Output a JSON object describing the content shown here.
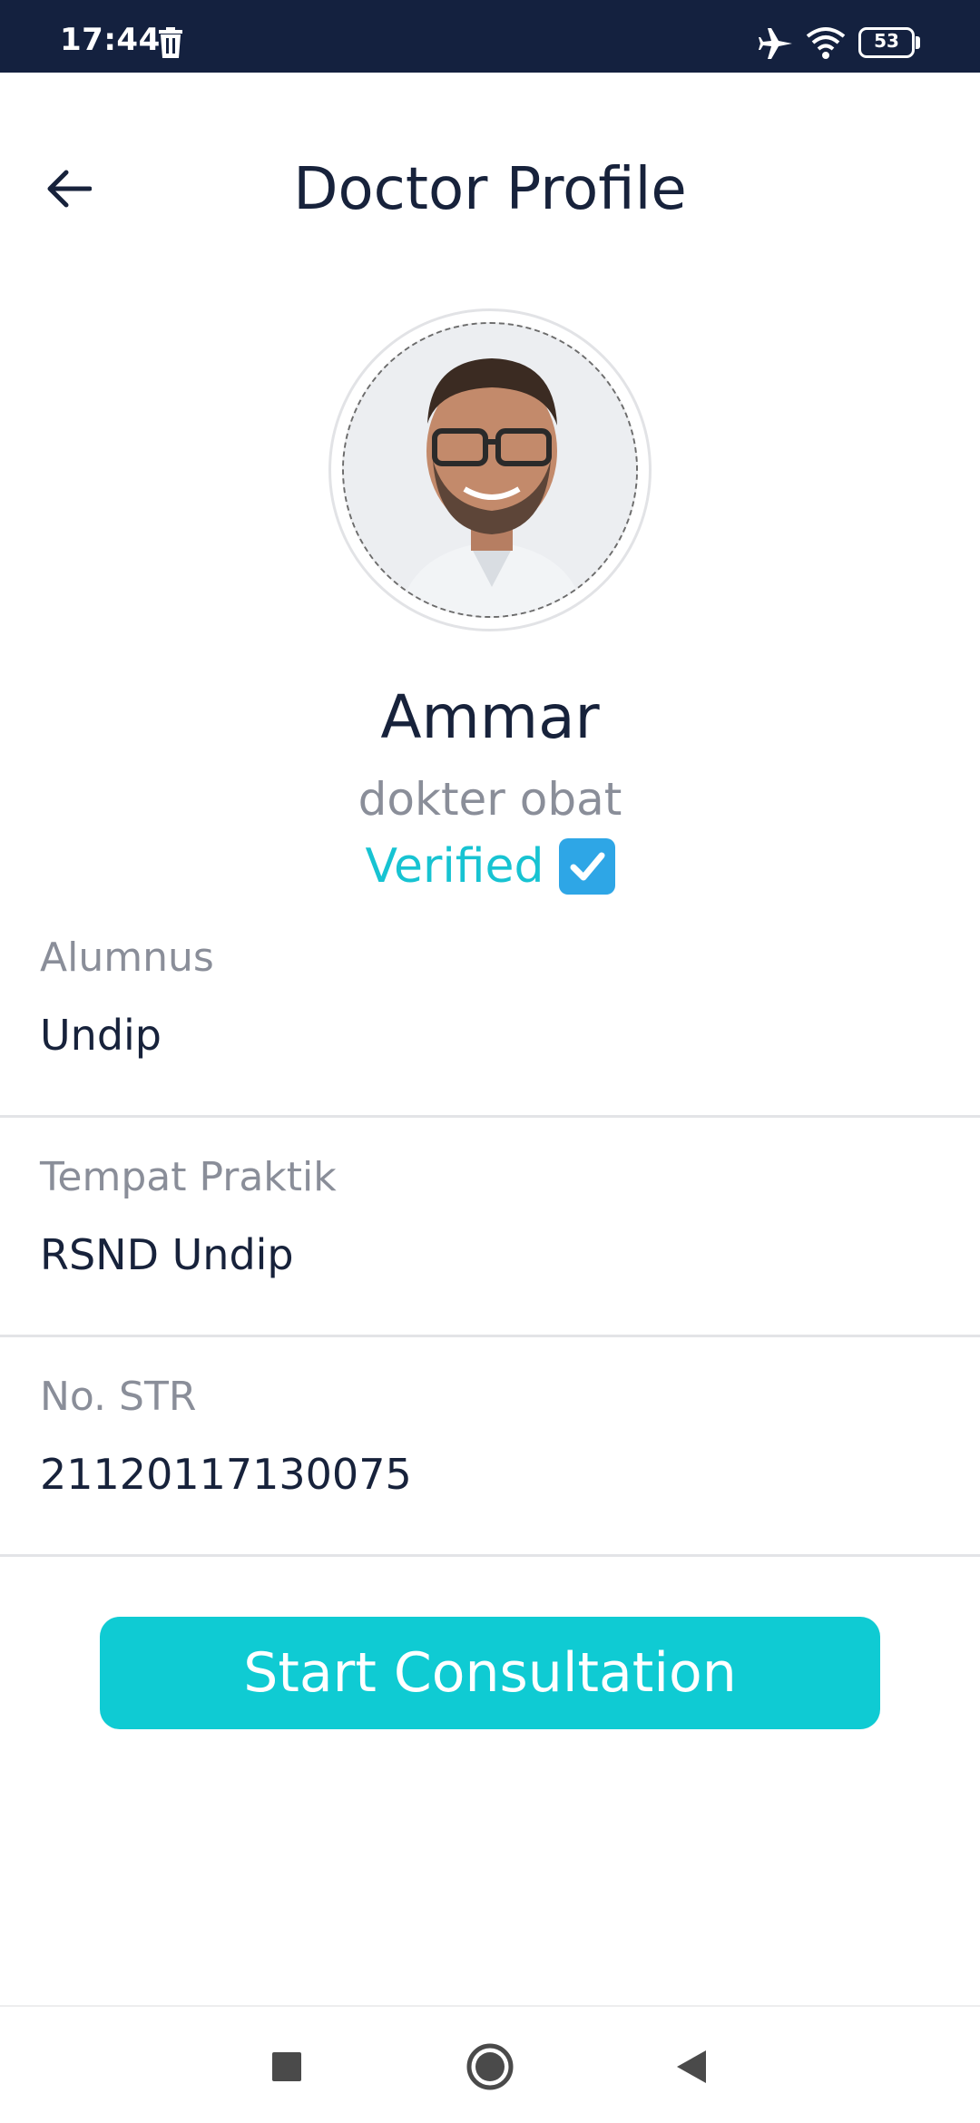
{
  "status_bar": {
    "time": "17:44",
    "battery": "53",
    "icons": [
      "trash-icon",
      "airplane-mode-icon",
      "wifi-icon",
      "battery-icon"
    ]
  },
  "header": {
    "title": "Doctor Profile",
    "back_icon": "arrow-left-icon"
  },
  "doctor": {
    "name": "Ammar",
    "specialty": "dokter obat",
    "verified_label": "Verified",
    "verified_icon": "check-box-icon"
  },
  "info": [
    {
      "label": "Alumnus",
      "value": "Undip"
    },
    {
      "label": "Tempat Praktik",
      "value": "RSND Undip"
    },
    {
      "label": "No. STR",
      "value": "21120117130075"
    }
  ],
  "cta": {
    "label": "Start Consultation"
  },
  "nav": {
    "icons": [
      "recents-square-icon",
      "home-circle-icon",
      "back-triangle-icon"
    ]
  },
  "colors": {
    "status_bar": "#14213f",
    "text_primary": "#17223b",
    "text_secondary": "#8a8e99",
    "accent": "#0fcbd3",
    "verified": "#17c3d2",
    "divider": "#e3e4e7"
  }
}
